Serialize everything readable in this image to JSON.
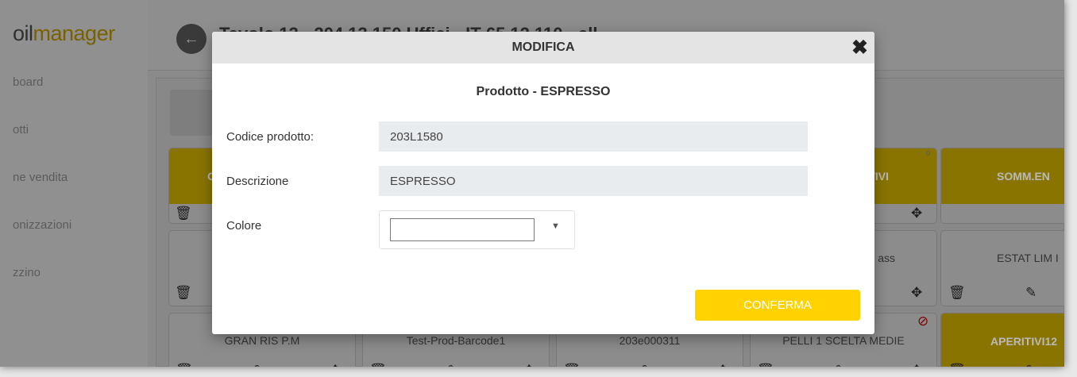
{
  "app": {
    "logo_part1": "oil",
    "logo_part2": "manager",
    "page_title": "Tavolo 13 · 204.13.150 Uffici · IT 65 12 110 · all"
  },
  "sidebar": {
    "items": [
      {
        "label": "board"
      },
      {
        "label": "otti"
      },
      {
        "label": "ne vendita"
      },
      {
        "label": "onizzazioni"
      },
      {
        "label": "zzino"
      }
    ]
  },
  "background_cards": {
    "row1": [
      {
        "label": "C"
      },
      {
        "label": "ITIVI",
        "badge": "0"
      },
      {
        "label": "SOMM.EN"
      }
    ],
    "row2": [
      {
        "label": "ass"
      },
      {
        "label": "ESTAT LIM I"
      }
    ],
    "row3": [
      {
        "label": "GRAN RIS P.M"
      },
      {
        "label": "Test-Prod-Barcode1"
      },
      {
        "label": "203e000311"
      },
      {
        "label": "PELLI 1 SCELTA MEDIE"
      },
      {
        "label": "APERITIVI12"
      }
    ]
  },
  "modal": {
    "title": "MODIFICA",
    "subtitle": "Prodotto - ESPRESSO",
    "fields": {
      "code_label": "Codice prodotto:",
      "code_value": "203L1580",
      "desc_label": "Descrizione",
      "desc_value": "ESPRESSO",
      "color_label": "Colore"
    },
    "confirm_label": "CONFERMA"
  },
  "colors": {
    "accent": "#ffd200",
    "category_yellow": "#f5c400"
  },
  "icons": {
    "back": "back-arrow-icon",
    "close": "close-icon",
    "trash": "trash-icon",
    "edit": "edit-icon",
    "move": "move-icon",
    "ban": "ban-icon",
    "caret": "caret-down-icon"
  }
}
